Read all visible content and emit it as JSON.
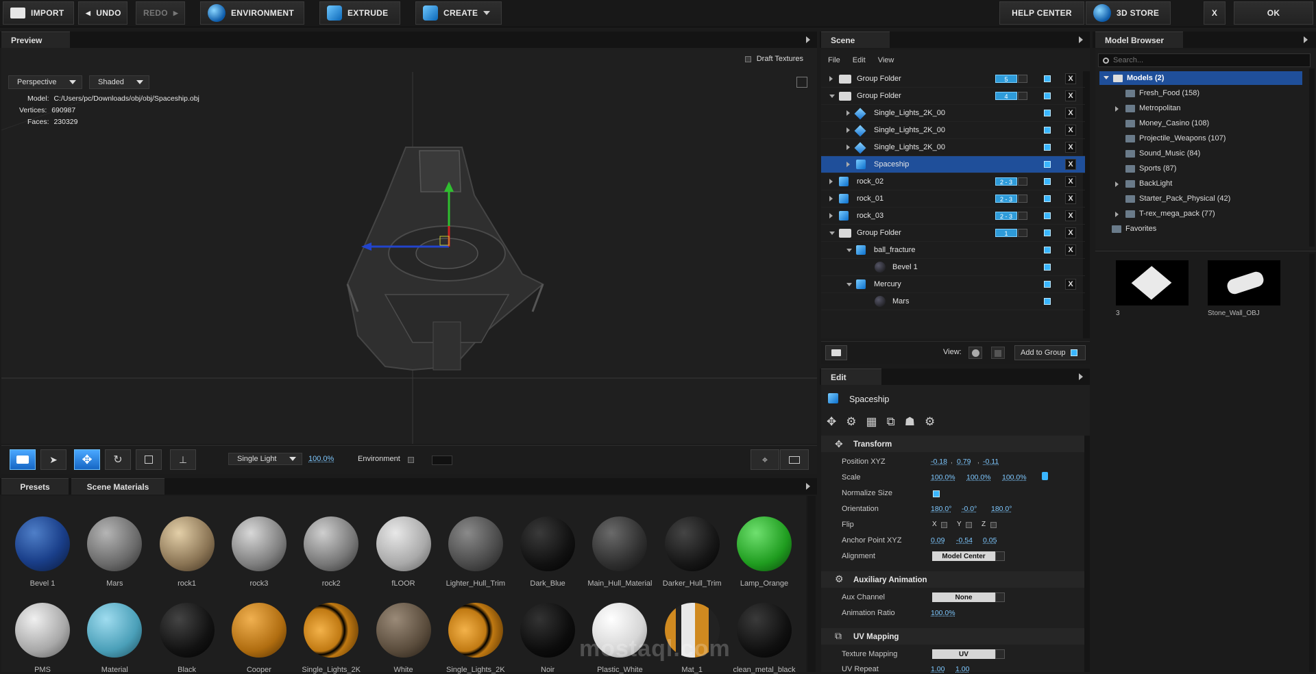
{
  "toolbar": {
    "import": "IMPORT",
    "undo": "UNDO",
    "redo": "REDO",
    "environment": "ENVIRONMENT",
    "extrude": "EXTRUDE",
    "create": "CREATE",
    "help_center": "HELP CENTER",
    "store": "3D STORE",
    "close": "X",
    "ok": "OK"
  },
  "preview": {
    "tab": "Preview",
    "draft_textures": "Draft Textures",
    "camera_mode": "Perspective",
    "render_mode": "Shaded",
    "model_label": "Model:",
    "model_path": "C:/Users/pc/Downloads/obj/obj/Spaceship.obj",
    "vertices_label": "Vertices:",
    "vertices": "690987",
    "faces_label": "Faces:",
    "faces": "230329",
    "light_mode": "Single Light",
    "light_pct": "100.0%",
    "environment_label": "Environment"
  },
  "scene": {
    "tab": "Scene",
    "menu": [
      "File",
      "Edit",
      "View"
    ],
    "rows": [
      {
        "name": "Group Folder",
        "badge": "5"
      },
      {
        "name": "Group Folder",
        "badge": "4"
      },
      {
        "name": "Single_Lights_2K_00"
      },
      {
        "name": "Single_Lights_2K_00"
      },
      {
        "name": "Single_Lights_2K_00"
      },
      {
        "name": "Spaceship"
      },
      {
        "name": "rock_02",
        "badge": "2 - 3"
      },
      {
        "name": "rock_01",
        "badge": "2 - 3"
      },
      {
        "name": "rock_03",
        "badge": "2 - 3"
      },
      {
        "name": "Group Folder",
        "badge": "1"
      },
      {
        "name": "ball_fracture"
      },
      {
        "name": "Bevel 1"
      },
      {
        "name": "Mercury"
      },
      {
        "name": "Mars"
      }
    ],
    "view_label": "View:",
    "add_to_group": "Add to Group",
    "close": "X"
  },
  "edit": {
    "tab": "Edit",
    "object_name": "Spaceship",
    "transform": "Transform",
    "position_label": "Position XYZ",
    "position": [
      "-0.18",
      "0.79",
      "-0.11"
    ],
    "scale_label": "Scale",
    "scale": [
      "100.0%",
      "100.0%",
      "100.0%"
    ],
    "normalize_label": "Normalize Size",
    "orientation_label": "Orientation",
    "orientation": [
      "180.0°",
      "-0.0°",
      "180.0°"
    ],
    "flip_label": "Flip",
    "flip_axes": [
      "X",
      "Y",
      "Z"
    ],
    "anchor_label": "Anchor Point XYZ",
    "anchor": [
      "0.09",
      "-0.54",
      "0.05"
    ],
    "alignment_label": "Alignment",
    "alignment_value": "Model Center",
    "aux_anim": "Auxiliary Animation",
    "aux_channel_label": "Aux Channel",
    "aux_channel_value": "None",
    "anim_ratio_label": "Animation Ratio",
    "anim_ratio": "100.0%",
    "uv_mapping": "UV Mapping",
    "texture_mapping_label": "Texture Mapping",
    "texture_mapping_value": "UV",
    "uv_repeat_label": "UV Repeat",
    "uv_repeat": [
      "1.00",
      "1.00"
    ]
  },
  "browser": {
    "tab": "Model Browser",
    "search_placeholder": "Search...",
    "root": "Models (2)",
    "items": [
      "Fresh_Food (158)",
      "Metropolitan",
      "Money_Casino (108)",
      "Projectile_Weapons (107)",
      "Sound_Music (84)",
      "Sports (87)",
      "BackLight",
      "Starter_Pack_Physical (42)",
      "T-rex_mega_pack (77)",
      "Favorites"
    ],
    "thumbs": [
      "3",
      "Stone_Wall_OBJ"
    ]
  },
  "materials": {
    "tabs": [
      "Presets",
      "Scene Materials"
    ],
    "row1": [
      "Bevel 1",
      "Mars",
      "rock1",
      "rock3",
      "rock2",
      "fLOOR",
      "Lighter_Hull_Trim",
      "Dark_Blue",
      "Main_Hull_Material",
      "Darker_Hull_Trim",
      "Lamp_Orange"
    ],
    "row2": [
      "PMS",
      "Material",
      "Black",
      "Cooper",
      "Single_Lights_2K",
      "White",
      "Single_Lights_2K",
      "Noir",
      "Plastic_White",
      "Mat_1",
      "clean_metal_black"
    ]
  },
  "watermark": "mostaql.com",
  "colors": {
    "accent": "#2e9bd9",
    "selection": "#1f4f9a"
  }
}
